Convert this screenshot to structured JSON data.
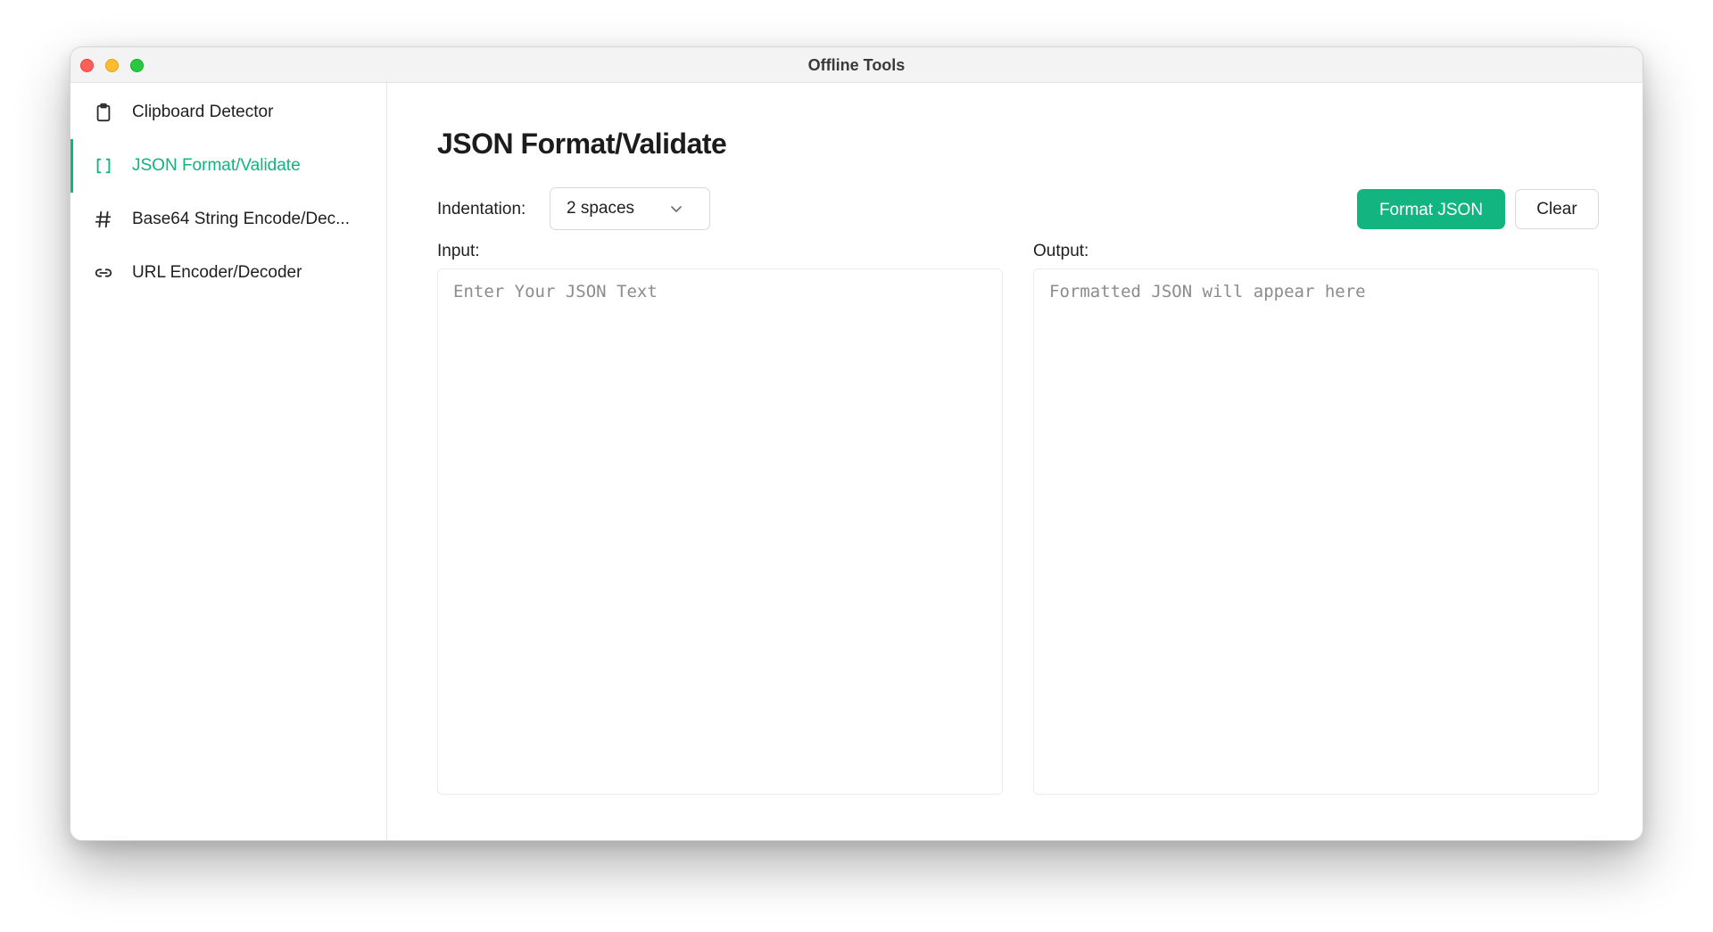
{
  "window": {
    "title": "Offline Tools"
  },
  "sidebar": {
    "items": [
      {
        "label": "Clipboard Detector",
        "icon": "clipboard-icon",
        "active": false
      },
      {
        "label": "JSON Format/Validate",
        "icon": "brackets-icon",
        "active": true
      },
      {
        "label": "Base64 String Encode/Dec...",
        "icon": "hash-icon",
        "active": false
      },
      {
        "label": "URL Encoder/Decoder",
        "icon": "link-icon",
        "active": false
      }
    ]
  },
  "main": {
    "title": "JSON Format/Validate",
    "indentation": {
      "label": "Indentation:",
      "selected": "2 spaces"
    },
    "format_button": "Format JSON",
    "clear_button": "Clear",
    "input": {
      "label": "Input:",
      "value": "",
      "placeholder": "Enter Your JSON Text"
    },
    "output": {
      "label": "Output:",
      "value": "",
      "placeholder": "Formatted JSON will appear here"
    }
  },
  "colors": {
    "accent": "#12b47f",
    "text": "#1f1f21",
    "border": "#d9d9dc"
  }
}
